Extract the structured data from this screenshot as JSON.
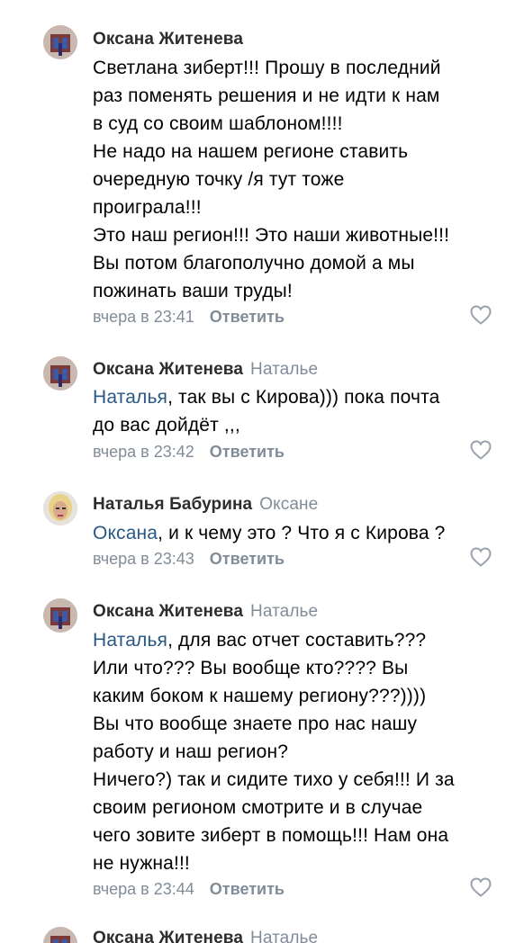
{
  "comments": [
    {
      "author": "Оксана Житенева",
      "reply_to": "",
      "mention": "",
      "lines": [
        "Светлана зиберт!!! Прошу в последний",
        "раз поменять решения и не идти к нам",
        "в суд со своим шаблоном!!!!",
        "Не надо на нашем регионе ставить",
        "очередную точку /я тут тоже",
        "проиграла!!!",
        "Это наш регион!!! Это наши животные!!!",
        "Вы потом благополучно домой а мы",
        "пожинать ваши труды!"
      ],
      "time": "вчера в 23:41",
      "reply_label": "Ответить"
    },
    {
      "author": "Оксана Житенева",
      "reply_to": "Наталье",
      "mention": "Наталья",
      "lines": [
        ", так вы с Кирова))) пока почта",
        "до вас дойдёт ,,,"
      ],
      "time": "вчера в 23:42",
      "reply_label": "Ответить"
    },
    {
      "author": "Наталья Бабурина",
      "reply_to": "Оксане",
      "mention": "Оксана",
      "lines": [
        ", и к чему это ? Что я с Кирова ?"
      ],
      "time": "вчера в 23:43",
      "reply_label": "Ответить"
    },
    {
      "author": "Оксана Житенева",
      "reply_to": "Наталье",
      "mention": "Наталья",
      "lines": [
        ", для вас отчет составить???",
        "Или что??? Вы вообще кто???? Вы",
        "каким боком к нашему региону???))))",
        "Вы что вообще знаете про нас нашу",
        "работу и наш регион?",
        "Ничего?) так и сидите тихо у себя!!! И за",
        "своим регионом смотрите и в случае",
        "чего зовите зиберт в помощь!!! Нам она",
        "не нужна!!!"
      ],
      "time": "вчера в 23:44",
      "reply_label": "Ответить"
    },
    {
      "author": "Оксана Житенева",
      "reply_to": "Наталье",
      "partial": true
    }
  ],
  "colors": {
    "mention": "#2a5885",
    "meta": "#818c99",
    "author": "#2c2d2e"
  },
  "icons": {
    "like": "heart-outline-icon"
  }
}
